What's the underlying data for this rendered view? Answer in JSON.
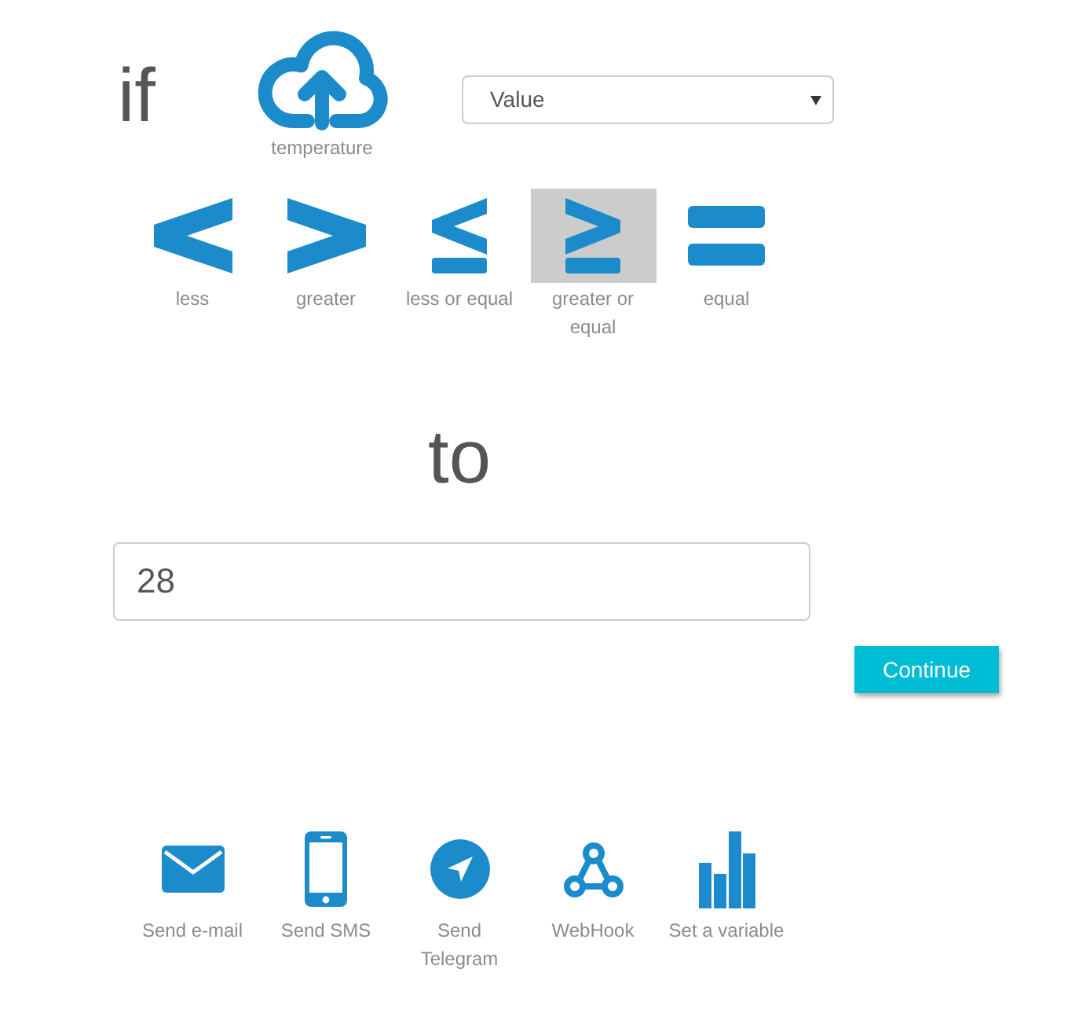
{
  "condition": {
    "keyword": "if",
    "sensor": {
      "label": "temperature"
    },
    "dropdown": {
      "value": "Value"
    }
  },
  "operators": [
    {
      "kind": "less",
      "label": "less",
      "selected": false
    },
    {
      "kind": "greater",
      "label": "greater",
      "selected": false
    },
    {
      "kind": "less_or_equal",
      "label": "less or equal",
      "selected": false
    },
    {
      "kind": "greater_or_equal",
      "label": "greater or equal",
      "selected": true
    },
    {
      "kind": "equal",
      "label": "equal",
      "selected": false
    }
  ],
  "target": {
    "keyword": "to",
    "input": {
      "value": "28"
    }
  },
  "continue_button": {
    "label": "Continue"
  },
  "actions": [
    {
      "kind": "email",
      "label": "Send e-mail"
    },
    {
      "kind": "sms",
      "label": "Send SMS"
    },
    {
      "kind": "telegram",
      "label": "Send Telegram"
    },
    {
      "kind": "webhook",
      "label": "WebHook"
    },
    {
      "kind": "variable",
      "label": "Set a variable"
    }
  ]
}
